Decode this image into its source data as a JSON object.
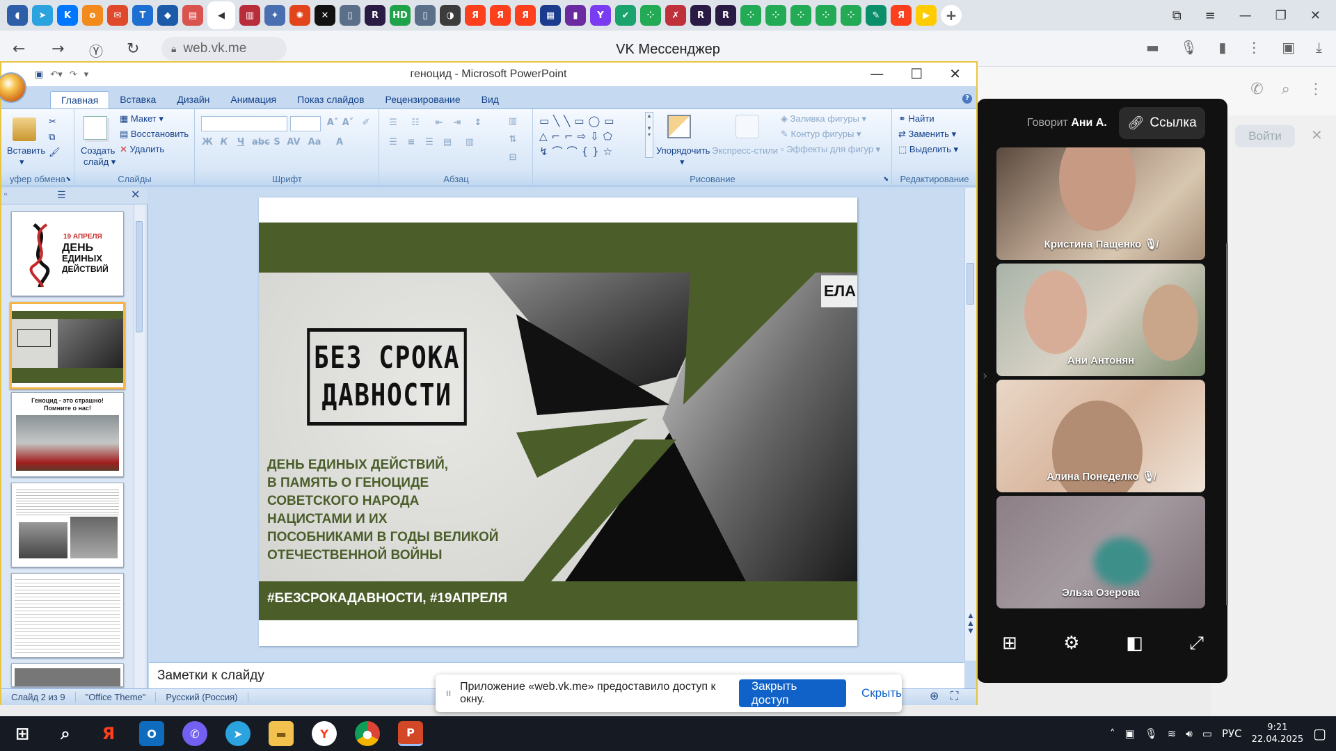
{
  "browser": {
    "url": "web.vk.me",
    "page_title": "VK Мессенджер",
    "tab_icons": [
      {
        "name": "speaker-tab-icon",
        "color": "#2d5fa8",
        "glyph": "◖"
      },
      {
        "name": "telegram-tab-icon",
        "color": "#2aa3df",
        "glyph": "➤"
      },
      {
        "name": "vk-tab-icon",
        "color": "#0077ff",
        "glyph": "K"
      },
      {
        "name": "ok-tab-icon",
        "color": "#f28b1b",
        "glyph": "о"
      },
      {
        "name": "mail-tab-icon",
        "color": "#e04a2c",
        "glyph": "✉"
      },
      {
        "name": "t-tab-icon",
        "color": "#1d6fd1",
        "glyph": "T"
      },
      {
        "name": "app-tab-icon",
        "color": "#1b5aa8",
        "glyph": "◆"
      },
      {
        "name": "doc-tab-icon",
        "color": "#d9534f",
        "glyph": "▤"
      },
      {
        "name": "active-speaker-tab-icon",
        "color": "#ffffff",
        "glyph": "◀"
      },
      {
        "name": "bars-tab-icon",
        "color": "#b82d3a",
        "glyph": "▥"
      },
      {
        "name": "puzzle-tab-icon",
        "color": "#4a6fb0",
        "glyph": "✦"
      },
      {
        "name": "game-tab-icon",
        "color": "#e2451b",
        "glyph": "✺"
      },
      {
        "name": "x-tab-icon",
        "color": "#111111",
        "glyph": "✕"
      },
      {
        "name": "page-tab-icon",
        "color": "#5a6f8a",
        "glyph": "▯"
      },
      {
        "name": "r-tab-icon",
        "color": "#2a1b45",
        "glyph": "R"
      },
      {
        "name": "hd-tab-icon",
        "color": "#1fa34a",
        "glyph": "HD"
      },
      {
        "name": "page2-tab-icon",
        "color": "#5a6f8a",
        "glyph": "▯"
      },
      {
        "name": "mixer-tab-icon",
        "color": "#3c3c3c",
        "glyph": "◑"
      },
      {
        "name": "yandex-tab-icon",
        "color": "#fc3f1d",
        "glyph": "Я"
      },
      {
        "name": "yandex2-tab-icon",
        "color": "#fc3f1d",
        "glyph": "Я"
      },
      {
        "name": "yandex3-tab-icon",
        "color": "#fc3f1d",
        "glyph": "Я"
      },
      {
        "name": "school-tab-icon",
        "color": "#1b3b8c",
        "glyph": "▦"
      },
      {
        "name": "purple-tab-icon",
        "color": "#6a2aa0",
        "glyph": "▮"
      },
      {
        "name": "y-tab-icon",
        "color": "#7a3cf0",
        "glyph": "Y"
      },
      {
        "name": "check-tab-icon",
        "color": "#1aa36c",
        "glyph": "✔"
      },
      {
        "name": "dots-tab-icon",
        "color": "#22aa55",
        "glyph": "⁘"
      },
      {
        "name": "red-tab-icon",
        "color": "#c0303a",
        "glyph": "✗"
      },
      {
        "name": "r2-tab-icon",
        "color": "#2a1b45",
        "glyph": "R"
      },
      {
        "name": "r3-tab-icon",
        "color": "#2a1b45",
        "glyph": "R"
      },
      {
        "name": "dots2-tab-icon",
        "color": "#22aa55",
        "glyph": "⁘"
      },
      {
        "name": "dots3-tab-icon",
        "color": "#22aa55",
        "glyph": "⁘"
      },
      {
        "name": "dots4-tab-icon",
        "color": "#22aa55",
        "glyph": "⁘"
      },
      {
        "name": "dots5-tab-icon",
        "color": "#22aa55",
        "glyph": "⁘"
      },
      {
        "name": "dots6-tab-icon",
        "color": "#22aa55",
        "glyph": "⁘"
      },
      {
        "name": "note-tab-icon",
        "color": "#0b8f6a",
        "glyph": "✎"
      },
      {
        "name": "yandex4-tab-icon",
        "color": "#fc3f1d",
        "glyph": "Я"
      },
      {
        "name": "play-tab-icon",
        "color": "#ffcc00",
        "glyph": "▶"
      }
    ]
  },
  "vk": {
    "speaking_prefix": "Говорит",
    "speaking_name": "Ани А.",
    "link_label": "Ссылка",
    "login_label": "Войти",
    "participants": [
      {
        "name": "Кристина Пащенко",
        "muted": true
      },
      {
        "name": "Ани Антонян",
        "muted": false
      },
      {
        "name": "Алина Понеделко",
        "muted": true
      },
      {
        "name": "Эльза Озерова",
        "muted": false
      }
    ]
  },
  "ppt": {
    "window_title": "геноцид - Microsoft PowerPoint",
    "tabs": [
      "Главная",
      "Вставка",
      "Дизайн",
      "Анимация",
      "Показ слайдов",
      "Рецензирование",
      "Вид"
    ],
    "groups": {
      "clipboard": {
        "label": "уфер обмена",
        "paste": "Вставить"
      },
      "slides": {
        "label": "Слайды",
        "create": "Создать",
        "create2": "слайд",
        "layout": "Макет",
        "reset": "Восстановить",
        "delete": "Удалить"
      },
      "font": {
        "label": "Шрифт"
      },
      "paragraph": {
        "label": "Абзац"
      },
      "drawing": {
        "label": "Рисование",
        "arrange": "Упорядочить",
        "quick_styles": "Экспресс-стили",
        "fill": "Заливка фигуры",
        "outline": "Контур фигуры",
        "effects": "Эффекты для фигур"
      },
      "editing": {
        "label": "Редактирование",
        "find": "Найти",
        "replace": "Заменить",
        "select": "Выделить"
      }
    },
    "notes_placeholder": "Заметки к слайду",
    "status": {
      "slide": "Слайд 2 из 9",
      "theme": "\"Office Theme\"",
      "lang": "Русский (Россия)"
    },
    "slide": {
      "title_line1": "БЕЗ СРОКА",
      "title_line2": "ДАВНОСТИ",
      "body_lines": [
        "ДЕНЬ ЕДИНЫХ ДЕЙСТВИЙ,",
        "В ПАМЯТЬ О ГЕНОЦИДЕ",
        "СОВЕТСКОГО НАРОДА",
        "НАЦИСТАМИ И ИХ",
        "ПОСОБНИКАМИ В ГОДЫ ВЕЛИКОЙ",
        "ОТЕЧЕСТВЕННОЙ ВОЙНЫ"
      ],
      "hashtags": "#БЕЗСРОКАДАВНОСТИ, #19АПРЕЛЯ",
      "sign_text": "ЕЛА",
      "accent": "#4b5e2a"
    },
    "thumbs": {
      "t1_line1": "19 АПРЕЛЯ",
      "t1_line2": "ДЕНЬ",
      "t1_line3": "ЕДИНЫХ",
      "t1_line4": "ДЕЙСТВИЙ",
      "t3_line1": "Геноцид - это страшно!",
      "t3_line2": "Помните о нас!"
    }
  },
  "share_bar": {
    "message": "Приложение «web.vk.me» предоставило доступ к окну.",
    "close_label": "Закрыть доступ",
    "hide_label": "Скрыть"
  },
  "taskbar": {
    "lang": "РУС",
    "time": "9:21",
    "date": "22.04.2025"
  }
}
